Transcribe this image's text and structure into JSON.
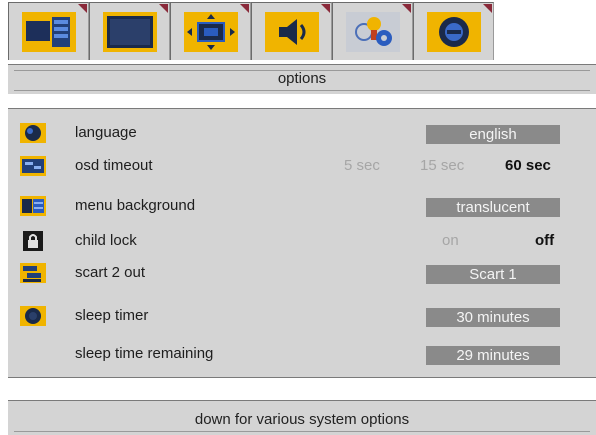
{
  "tabs": [
    {
      "icon": "picture-settings-icon"
    },
    {
      "icon": "screen-icon"
    },
    {
      "icon": "geometry-icon"
    },
    {
      "icon": "sound-icon"
    },
    {
      "icon": "features-icon"
    },
    {
      "icon": "options-icon"
    }
  ],
  "header": {
    "title": "options"
  },
  "options": {
    "language": {
      "label": "language",
      "value": "english"
    },
    "osd_timeout": {
      "label": "osd timeout",
      "choices": [
        "5 sec",
        "15 sec",
        "60 sec"
      ],
      "selected": "60 sec"
    },
    "menu_background": {
      "label": "menu background",
      "value": "translucent"
    },
    "child_lock": {
      "label": "child lock",
      "choices": [
        "on",
        "off"
      ],
      "selected": "off"
    },
    "scart_2_out": {
      "label": "scart 2 out",
      "value": "Scart 1"
    },
    "sleep_timer": {
      "label": "sleep timer",
      "value": "30  minutes"
    },
    "sleep_time_remaining": {
      "label": "sleep time remaining",
      "value": "29  minutes"
    }
  },
  "help": {
    "text": "down for various system options"
  },
  "colors": {
    "panel": "#d4d4d4",
    "value_box": "#8a8a8a",
    "icon_yellow": "#f0b400",
    "icon_blue": "#2a5cbf",
    "tab_marker": "#8a2a3a"
  }
}
